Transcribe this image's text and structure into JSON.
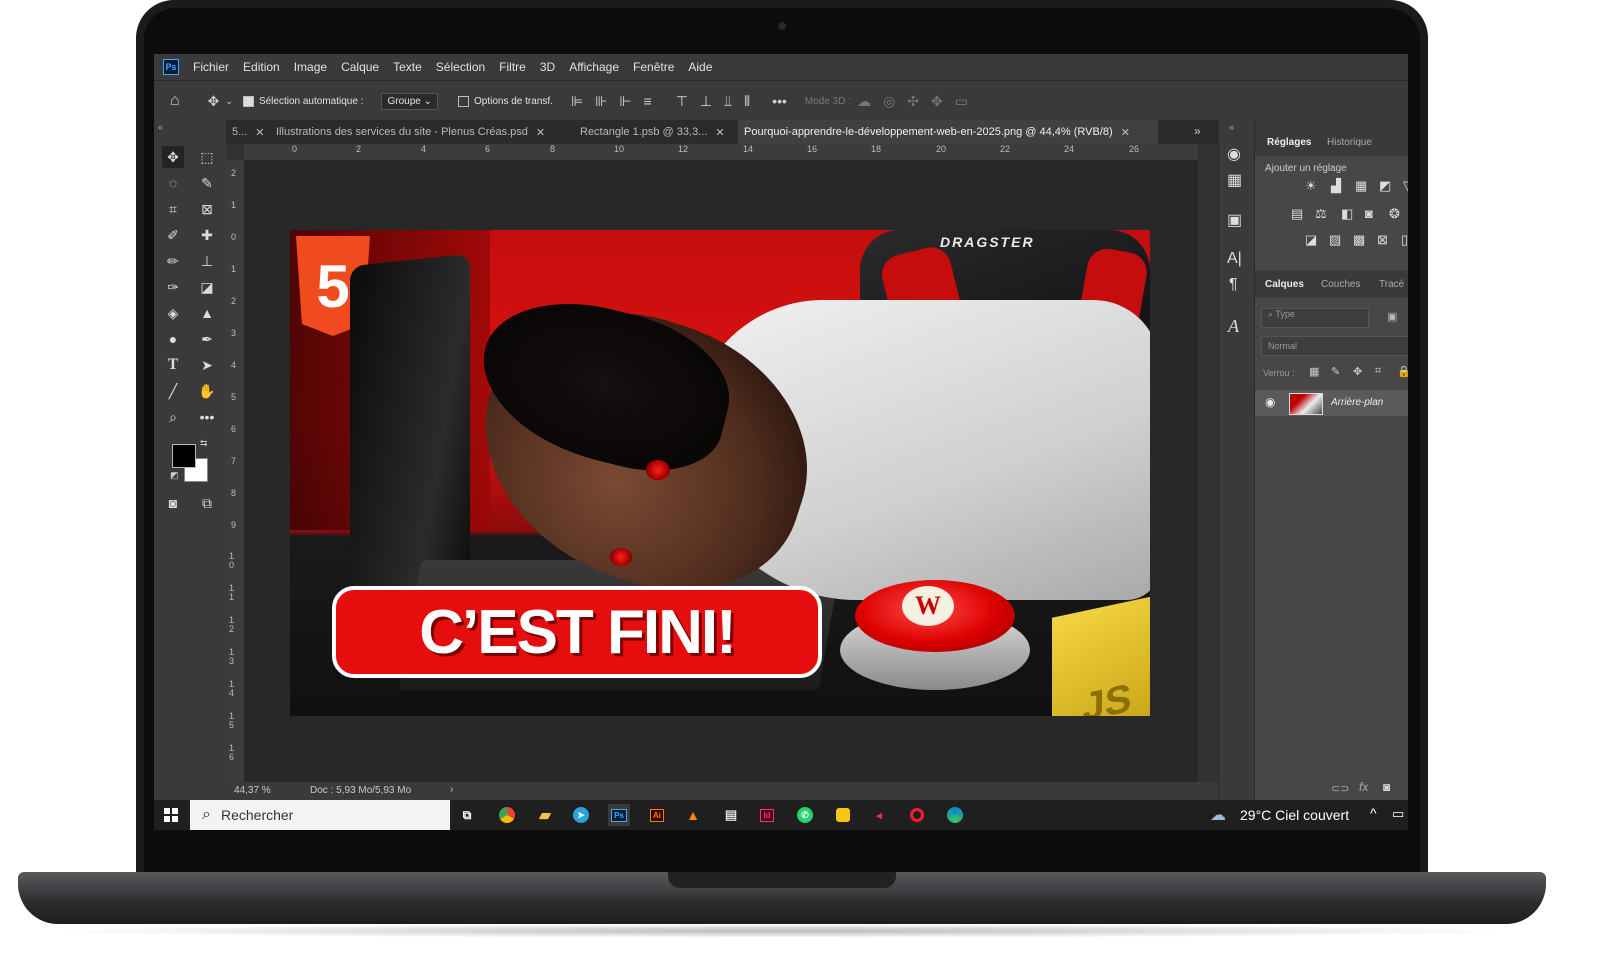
{
  "app": {
    "logo": "Ps"
  },
  "menu": [
    "Fichier",
    "Edition",
    "Image",
    "Calque",
    "Texte",
    "Sélection",
    "Filtre",
    "3D",
    "Affichage",
    "Fenêtre",
    "Aide"
  ],
  "options_bar": {
    "auto_select_label": "Sélection automatique :",
    "group_select": "Groupe",
    "transform_options_label": "Options de transf.",
    "mode3d_label": "Mode 3D :"
  },
  "tabs": [
    {
      "label": "5..."
    },
    {
      "label": "Illustrations des services du site - Plenus Créas.psd"
    },
    {
      "label": "Rectangle 1.psb @ 33,3..."
    },
    {
      "label": "Pourquoi-apprendre-le-développement-web-en-2025.png @ 44,4% (RVB/8)"
    }
  ],
  "ruler_h": [
    "0",
    "2",
    "4",
    "6",
    "8",
    "10",
    "12",
    "14",
    "16",
    "18",
    "20",
    "22",
    "24",
    "26"
  ],
  "ruler_v": [
    "2",
    "1",
    "0",
    "1",
    "2",
    "3",
    "4",
    "5",
    "6",
    "7",
    "8",
    "9",
    "1 0",
    "1 1",
    "1 2",
    "1 3",
    "1 4",
    "1 5",
    "1 6"
  ],
  "artwork": {
    "headline": "C’EST FINI!",
    "chair_brand": "DRAGSTER",
    "html_badge": "5",
    "js_badge": "JS",
    "wp_badge": "W"
  },
  "status": {
    "zoom": "44,37 %",
    "doc": "Doc : 5,93 Mo/5,93 Mo"
  },
  "adjust_panel": {
    "tab1": "Réglages",
    "tab2": "Historique",
    "add_label": "Ajouter un réglage"
  },
  "layers_panel": {
    "tab1": "Calques",
    "tab2": "Couches",
    "tab3": "Tracé",
    "filter_placeholder": "Type",
    "blend_mode": "Normal",
    "lock_label": "Verrou :",
    "layer_name": "Arrière-plan"
  },
  "taskbar": {
    "search_placeholder": "Rechercher",
    "weather": "29°C  Ciel couvert",
    "pinned": [
      "chrome",
      "folder",
      "telegram",
      "photoshop",
      "illustrator",
      "vlc",
      "app",
      "indesign",
      "whatsapp",
      "app2",
      "app3",
      "opera",
      "edge"
    ]
  },
  "colors": {
    "accent_red": "#e41010",
    "ps_blue": "#4aa4ff",
    "panel_bg": "#474747"
  }
}
